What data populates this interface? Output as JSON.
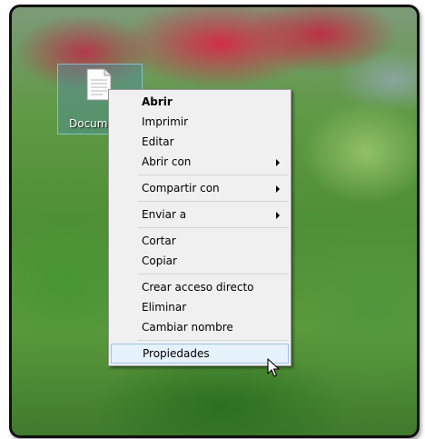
{
  "desktop": {
    "icon_label": "Docume"
  },
  "context_menu": {
    "items": [
      {
        "label": "Abrir",
        "bold": true,
        "submenu": false
      },
      {
        "label": "Imprimir",
        "bold": false,
        "submenu": false
      },
      {
        "label": "Editar",
        "bold": false,
        "submenu": false
      },
      {
        "label": "Abrir con",
        "bold": false,
        "submenu": true
      },
      {
        "label": "Compartir con",
        "bold": false,
        "submenu": true
      },
      {
        "label": "Enviar a",
        "bold": false,
        "submenu": true
      },
      {
        "label": "Cortar",
        "bold": false,
        "submenu": false
      },
      {
        "label": "Copiar",
        "bold": false,
        "submenu": false
      },
      {
        "label": "Crear acceso directo",
        "bold": false,
        "submenu": false
      },
      {
        "label": "Eliminar",
        "bold": false,
        "submenu": false
      },
      {
        "label": "Cambiar nombre",
        "bold": false,
        "submenu": false
      },
      {
        "label": "Propiedades",
        "bold": false,
        "submenu": false,
        "hovered": true
      }
    ]
  },
  "colors": {
    "menu_background": "#f0f0f0",
    "menu_border": "#979797",
    "hover_background": "#e5f1fb",
    "hover_border": "#9fc3e6",
    "icon_selection": "#508ca0"
  },
  "cursor": "arrow-pointer-icon"
}
